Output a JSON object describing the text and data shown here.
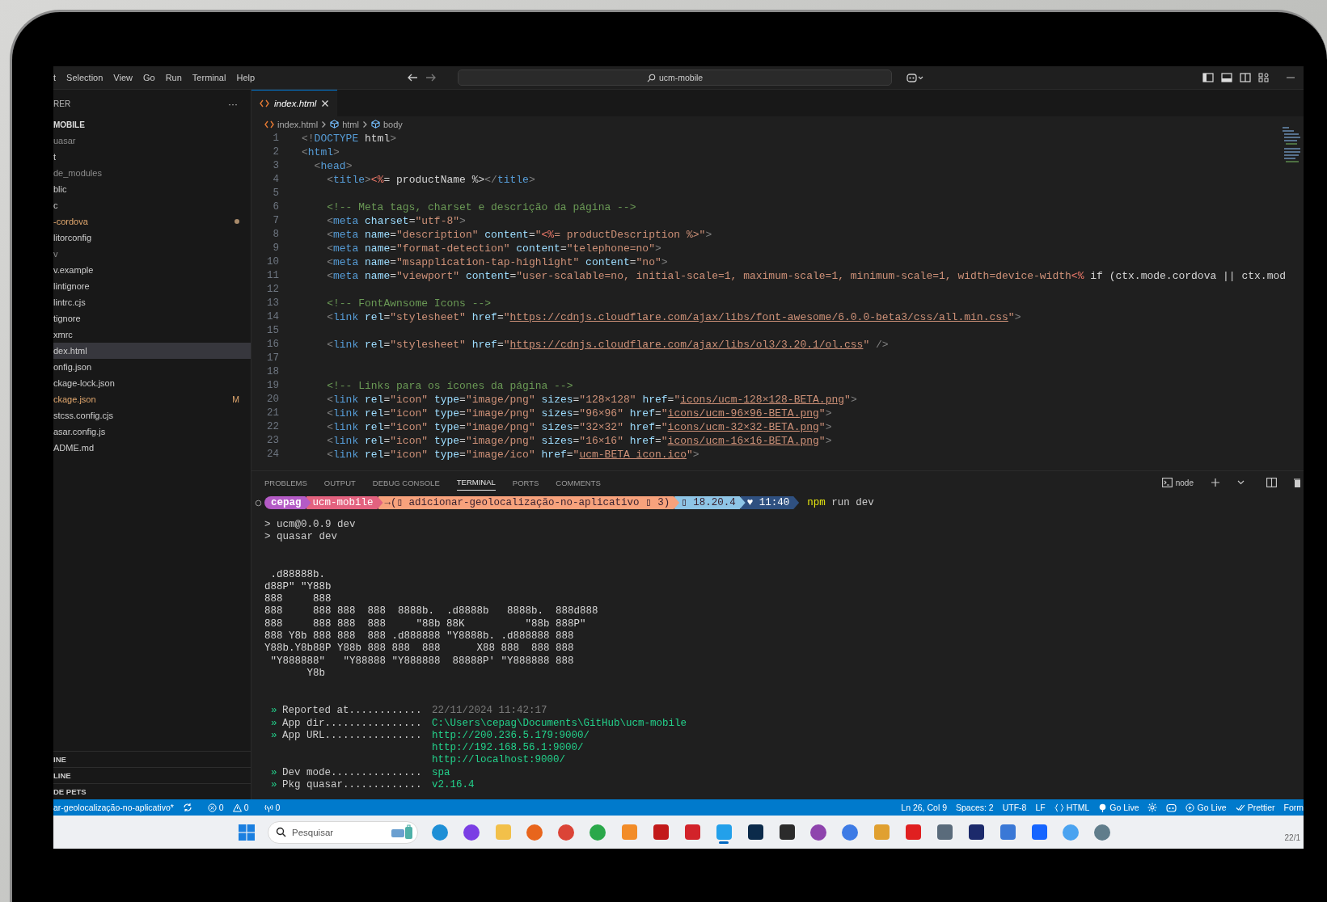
{
  "menu": [
    "t",
    "Selection",
    "View",
    "Go",
    "Run",
    "Terminal",
    "Help"
  ],
  "search": {
    "value": "ucm-mobile"
  },
  "sidebar": {
    "title": "RER",
    "more": "···",
    "project": "MOBILE",
    "items": [
      {
        "label": "uasar",
        "ignored": true,
        "modified": false,
        "selected": false
      },
      {
        "label": "t",
        "ignored": false,
        "modified": false,
        "selected": false
      },
      {
        "label": "de_modules",
        "ignored": true,
        "modified": false,
        "selected": false
      },
      {
        "label": "blic",
        "ignored": false,
        "modified": false,
        "selected": false
      },
      {
        "label": "c",
        "ignored": false,
        "modified": false,
        "selected": false
      },
      {
        "label": "-cordova",
        "ignored": false,
        "modified": true,
        "selected": false
      },
      {
        "label": "litorconfig",
        "ignored": false,
        "modified": false,
        "selected": false
      },
      {
        "label": "v",
        "ignored": true,
        "modified": false,
        "selected": false
      },
      {
        "label": "v.example",
        "ignored": false,
        "modified": false,
        "selected": false
      },
      {
        "label": "lintignore",
        "ignored": false,
        "modified": false,
        "selected": false
      },
      {
        "label": "lintrc.cjs",
        "ignored": false,
        "modified": false,
        "selected": false
      },
      {
        "label": "tignore",
        "ignored": false,
        "modified": false,
        "selected": false
      },
      {
        "label": "xmrc",
        "ignored": false,
        "modified": false,
        "selected": false
      },
      {
        "label": "dex.html",
        "ignored": false,
        "modified": false,
        "selected": true
      },
      {
        "label": "onfig.json",
        "ignored": false,
        "modified": false,
        "selected": false
      },
      {
        "label": "ckage-lock.json",
        "ignored": false,
        "modified": false,
        "selected": false
      },
      {
        "label": "ckage.json",
        "ignored": false,
        "modified": true,
        "badge": "M",
        "selected": false
      },
      {
        "label": "stcss.config.cjs",
        "ignored": false,
        "modified": false,
        "selected": false
      },
      {
        "label": "asar.config.js",
        "ignored": false,
        "modified": false,
        "selected": false
      },
      {
        "label": "ADME.md",
        "ignored": false,
        "modified": false,
        "selected": false
      }
    ],
    "sections": [
      "INE",
      "LINE",
      "DE PETS"
    ]
  },
  "editor": {
    "tab": "index.html",
    "breadcrumbs": [
      "index.html",
      "html",
      "body"
    ],
    "lines": [
      {
        "number": "1",
        "tokens": [
          {
            "kind": "punct",
            "text": "<!"
          },
          {
            "kind": "tag",
            "text": "DOCTYPE"
          },
          {
            "kind": "plain",
            "text": " html"
          },
          {
            "kind": "punct",
            "text": ">"
          }
        ]
      },
      {
        "number": "2",
        "tokens": [
          {
            "kind": "punct",
            "text": "<"
          },
          {
            "kind": "tag",
            "text": "html"
          },
          {
            "kind": "punct",
            "text": ">"
          }
        ]
      },
      {
        "number": "3",
        "tokens": [
          {
            "kind": "punct",
            "text": "  <"
          },
          {
            "kind": "tag",
            "text": "head"
          },
          {
            "kind": "punct",
            "text": ">"
          }
        ]
      },
      {
        "number": "4",
        "tokens": [
          {
            "kind": "punct",
            "text": "    <"
          },
          {
            "kind": "tag",
            "text": "title"
          },
          {
            "kind": "punct",
            "text": ">"
          },
          {
            "kind": "template",
            "text": "<%"
          },
          {
            "kind": "plain",
            "text": "= productName %>"
          },
          {
            "kind": "punct",
            "text": "</"
          },
          {
            "kind": "tag",
            "text": "title"
          },
          {
            "kind": "punct",
            "text": ">"
          }
        ]
      },
      {
        "number": "5"
      },
      {
        "number": "6",
        "tokens": [
          {
            "kind": "comment",
            "text": "    <!-- Meta tags, charset e descrição da página -->"
          }
        ]
      },
      {
        "number": "7",
        "tokens": [
          {
            "kind": "punct",
            "text": "    <"
          },
          {
            "kind": "tag",
            "text": "meta"
          },
          {
            "kind": "attr",
            "text": " charset"
          },
          {
            "kind": "plain",
            "text": "="
          },
          {
            "kind": "string",
            "text": "\"utf-8\""
          },
          {
            "kind": "punct",
            "text": ">"
          }
        ]
      },
      {
        "number": "8",
        "tokens": [
          {
            "kind": "punct",
            "text": "    <"
          },
          {
            "kind": "tag",
            "text": "meta"
          },
          {
            "kind": "attr",
            "text": " name"
          },
          {
            "kind": "plain",
            "text": "="
          },
          {
            "kind": "string",
            "text": "\"description\""
          },
          {
            "kind": "attr",
            "text": " content"
          },
          {
            "kind": "plain",
            "text": "="
          },
          {
            "kind": "string",
            "text": "\""
          },
          {
            "kind": "template",
            "text": "<%"
          },
          {
            "kind": "string",
            "text": "= productDescription %>\""
          },
          {
            "kind": "punct",
            "text": ">"
          }
        ]
      },
      {
        "number": "9",
        "tokens": [
          {
            "kind": "punct",
            "text": "    <"
          },
          {
            "kind": "tag",
            "text": "meta"
          },
          {
            "kind": "attr",
            "text": " name"
          },
          {
            "kind": "plain",
            "text": "="
          },
          {
            "kind": "string",
            "text": "\"format-detection\""
          },
          {
            "kind": "attr",
            "text": " content"
          },
          {
            "kind": "plain",
            "text": "="
          },
          {
            "kind": "string",
            "text": "\"telephone=no\""
          },
          {
            "kind": "punct",
            "text": ">"
          }
        ]
      },
      {
        "number": "10",
        "tokens": [
          {
            "kind": "punct",
            "text": "    <"
          },
          {
            "kind": "tag",
            "text": "meta"
          },
          {
            "kind": "attr",
            "text": " name"
          },
          {
            "kind": "plain",
            "text": "="
          },
          {
            "kind": "string",
            "text": "\"msapplication-tap-highlight\""
          },
          {
            "kind": "attr",
            "text": " content"
          },
          {
            "kind": "plain",
            "text": "="
          },
          {
            "kind": "string",
            "text": "\"no\""
          },
          {
            "kind": "punct",
            "text": ">"
          }
        ]
      },
      {
        "number": "11",
        "tokens": [
          {
            "kind": "punct",
            "text": "    <"
          },
          {
            "kind": "tag",
            "text": "meta"
          },
          {
            "kind": "attr",
            "text": " name"
          },
          {
            "kind": "plain",
            "text": "="
          },
          {
            "kind": "string",
            "text": "\"viewport\""
          },
          {
            "kind": "attr",
            "text": " content"
          },
          {
            "kind": "plain",
            "text": "="
          },
          {
            "kind": "string",
            "text": "\"user-scalable=no, initial-scale=1, maximum-scale=1, minimum-scale=1, width=device-width"
          },
          {
            "kind": "template",
            "text": "<%"
          },
          {
            "kind": "plain",
            "text": " if (ctx.mode.cordova || ctx.mod"
          }
        ]
      },
      {
        "number": "12"
      },
      {
        "number": "13",
        "tokens": [
          {
            "kind": "comment",
            "text": "    <!-- FontAwnsome Icons -->"
          }
        ]
      },
      {
        "number": "14",
        "tokens": [
          {
            "kind": "punct",
            "text": "    <"
          },
          {
            "kind": "tag",
            "text": "link"
          },
          {
            "kind": "attr",
            "text": " rel"
          },
          {
            "kind": "plain",
            "text": "="
          },
          {
            "kind": "string",
            "text": "\"stylesheet\""
          },
          {
            "kind": "attr",
            "text": " href"
          },
          {
            "kind": "plain",
            "text": "="
          },
          {
            "kind": "string",
            "text": "\""
          },
          {
            "kind": "url",
            "text": "https://cdnjs.cloudflare.com/ajax/libs/font-awesome/6.0.0-beta3/css/all.min.css"
          },
          {
            "kind": "string",
            "text": "\""
          },
          {
            "kind": "punct",
            "text": ">"
          }
        ]
      },
      {
        "number": "15"
      },
      {
        "number": "16",
        "tokens": [
          {
            "kind": "punct",
            "text": "    <"
          },
          {
            "kind": "tag",
            "text": "link"
          },
          {
            "kind": "attr",
            "text": " rel"
          },
          {
            "kind": "plain",
            "text": "="
          },
          {
            "kind": "string",
            "text": "\"stylesheet\""
          },
          {
            "kind": "attr",
            "text": " href"
          },
          {
            "kind": "plain",
            "text": "="
          },
          {
            "kind": "string",
            "text": "\""
          },
          {
            "kind": "url",
            "text": "https://cdnjs.cloudflare.com/ajax/libs/ol3/3.20.1/ol.css"
          },
          {
            "kind": "string",
            "text": "\""
          },
          {
            "kind": "punct",
            "text": " />"
          }
        ]
      },
      {
        "number": "17"
      },
      {
        "number": "18"
      },
      {
        "number": "19",
        "tokens": [
          {
            "kind": "comment",
            "text": "    <!-- Links para os ícones da página -->"
          }
        ]
      },
      {
        "number": "20",
        "tokens": [
          {
            "kind": "punct",
            "text": "    <"
          },
          {
            "kind": "tag",
            "text": "link"
          },
          {
            "kind": "attr",
            "text": " rel"
          },
          {
            "kind": "plain",
            "text": "="
          },
          {
            "kind": "string",
            "text": "\"icon\""
          },
          {
            "kind": "attr",
            "text": " type"
          },
          {
            "kind": "plain",
            "text": "="
          },
          {
            "kind": "string",
            "text": "\"image/png\""
          },
          {
            "kind": "attr",
            "text": " sizes"
          },
          {
            "kind": "plain",
            "text": "="
          },
          {
            "kind": "string",
            "text": "\"128×128\""
          },
          {
            "kind": "attr",
            "text": " href"
          },
          {
            "kind": "plain",
            "text": "="
          },
          {
            "kind": "string",
            "text": "\""
          },
          {
            "kind": "url",
            "text": "icons/ucm-128×128-BETA.png"
          },
          {
            "kind": "string",
            "text": "\""
          },
          {
            "kind": "punct",
            "text": ">"
          }
        ]
      },
      {
        "number": "21",
        "tokens": [
          {
            "kind": "punct",
            "text": "    <"
          },
          {
            "kind": "tag",
            "text": "link"
          },
          {
            "kind": "attr",
            "text": " rel"
          },
          {
            "kind": "plain",
            "text": "="
          },
          {
            "kind": "string",
            "text": "\"icon\""
          },
          {
            "kind": "attr",
            "text": " type"
          },
          {
            "kind": "plain",
            "text": "="
          },
          {
            "kind": "string",
            "text": "\"image/png\""
          },
          {
            "kind": "attr",
            "text": " sizes"
          },
          {
            "kind": "plain",
            "text": "="
          },
          {
            "kind": "string",
            "text": "\"96×96\""
          },
          {
            "kind": "attr",
            "text": " href"
          },
          {
            "kind": "plain",
            "text": "="
          },
          {
            "kind": "string",
            "text": "\""
          },
          {
            "kind": "url",
            "text": "icons/ucm-96×96-BETA.png"
          },
          {
            "kind": "string",
            "text": "\""
          },
          {
            "kind": "punct",
            "text": ">"
          }
        ]
      },
      {
        "number": "22",
        "tokens": [
          {
            "kind": "punct",
            "text": "    <"
          },
          {
            "kind": "tag",
            "text": "link"
          },
          {
            "kind": "attr",
            "text": " rel"
          },
          {
            "kind": "plain",
            "text": "="
          },
          {
            "kind": "string",
            "text": "\"icon\""
          },
          {
            "kind": "attr",
            "text": " type"
          },
          {
            "kind": "plain",
            "text": "="
          },
          {
            "kind": "string",
            "text": "\"image/png\""
          },
          {
            "kind": "attr",
            "text": " sizes"
          },
          {
            "kind": "plain",
            "text": "="
          },
          {
            "kind": "string",
            "text": "\"32×32\""
          },
          {
            "kind": "attr",
            "text": " href"
          },
          {
            "kind": "plain",
            "text": "="
          },
          {
            "kind": "string",
            "text": "\""
          },
          {
            "kind": "url",
            "text": "icons/ucm-32×32-BETA.png"
          },
          {
            "kind": "string",
            "text": "\""
          },
          {
            "kind": "punct",
            "text": ">"
          }
        ]
      },
      {
        "number": "23",
        "tokens": [
          {
            "kind": "punct",
            "text": "    <"
          },
          {
            "kind": "tag",
            "text": "link"
          },
          {
            "kind": "attr",
            "text": " rel"
          },
          {
            "kind": "plain",
            "text": "="
          },
          {
            "kind": "string",
            "text": "\"icon\""
          },
          {
            "kind": "attr",
            "text": " type"
          },
          {
            "kind": "plain",
            "text": "="
          },
          {
            "kind": "string",
            "text": "\"image/png\""
          },
          {
            "kind": "attr",
            "text": " sizes"
          },
          {
            "kind": "plain",
            "text": "="
          },
          {
            "kind": "string",
            "text": "\"16×16\""
          },
          {
            "kind": "attr",
            "text": " href"
          },
          {
            "kind": "plain",
            "text": "="
          },
          {
            "kind": "string",
            "text": "\""
          },
          {
            "kind": "url",
            "text": "icons/ucm-16×16-BETA.png"
          },
          {
            "kind": "string",
            "text": "\""
          },
          {
            "kind": "punct",
            "text": ">"
          }
        ]
      },
      {
        "number": "24",
        "tokens": [
          {
            "kind": "punct",
            "text": "    <"
          },
          {
            "kind": "tag",
            "text": "link"
          },
          {
            "kind": "attr",
            "text": " rel"
          },
          {
            "kind": "plain",
            "text": "="
          },
          {
            "kind": "string",
            "text": "\"icon\""
          },
          {
            "kind": "attr",
            "text": " type"
          },
          {
            "kind": "plain",
            "text": "="
          },
          {
            "kind": "string",
            "text": "\"image/ico\""
          },
          {
            "kind": "attr",
            "text": " href"
          },
          {
            "kind": "plain",
            "text": "="
          },
          {
            "kind": "string",
            "text": "\""
          },
          {
            "kind": "url",
            "text": "ucm-BETA_icon.ico"
          },
          {
            "kind": "string",
            "text": "\""
          },
          {
            "kind": "punct",
            "text": ">"
          }
        ]
      }
    ]
  },
  "panel": {
    "tabs": [
      {
        "label": "PROBLEMS",
        "selected": false
      },
      {
        "label": "OUTPUT",
        "selected": false
      },
      {
        "label": "DEBUG CONSOLE",
        "selected": false
      },
      {
        "label": "TERMINAL",
        "selected": true
      },
      {
        "label": "PORTS",
        "selected": false
      },
      {
        "label": "COMMENTS",
        "selected": false
      }
    ],
    "terminal_name": "node",
    "prompt": [
      {
        "text": "cepag",
        "color": "#b45bc6"
      },
      {
        "text": "ucm-mobile",
        "color": "#e3627f"
      },
      {
        "text": "→(▯ adicionar-geolocalização-no-aplicativo ▯ 3)",
        "color": "#f7a27c"
      },
      {
        "text": "▯ 18.20.4",
        "color": "#8ec5e6"
      },
      {
        "text": "♥ 11:40",
        "color": "#2f5080"
      }
    ],
    "command": {
      "program": "npm",
      "args": "run dev"
    },
    "output": [
      "> ucm@0.0.9 dev",
      "> quasar dev"
    ],
    "banner": [
      " .d88888b.",
      "d88P\" \"Y88b",
      "888     888",
      "888     888 888  888  8888b.  .d8888b   8888b.  888d888",
      "888     888 888  888     \"88b 88K          \"88b 888P\"",
      "888 Y8b 888 888  888 .d888888 \"Y8888b. .d888888 888",
      "Y88b.Y8b88P Y88b 888 888  888      X88 888  888 888",
      " \"Y888888\"   \"Y88888 \"Y888888  88888P' \"Y888888 888",
      "       Y8b"
    ],
    "info": [
      {
        "marker": "»",
        "label": "Reported at............",
        "kind": "timestamp",
        "values": [
          "22/11/2024 11:42:17"
        ]
      },
      {
        "marker": "»",
        "label": "App dir................",
        "kind": "value",
        "values": [
          "C:\\Users\\cepag\\Documents\\GitHub\\ucm-mobile"
        ]
      },
      {
        "marker": "»",
        "label": "App URL................",
        "kind": "value",
        "values": [
          "http://200.236.5.179:9000/",
          "http://192.168.56.1:9000/",
          "http://localhost:9000/"
        ]
      },
      {
        "marker": "»",
        "label": "Dev mode...............",
        "kind": "value",
        "values": [
          "spa"
        ]
      },
      {
        "marker": "»",
        "label": "Pkg quasar.............",
        "kind": "value",
        "values": [
          "v2.16.4"
        ]
      }
    ]
  },
  "status_bar": {
    "left": [
      {
        "kind": "branch",
        "text": "ar-geolocalização-no-aplicativo*"
      },
      {
        "kind": "sync"
      },
      {
        "kind": "errors",
        "text": "0"
      },
      {
        "kind": "warnings",
        "text": "0"
      },
      {
        "kind": "ports",
        "text": "0"
      }
    ],
    "right": [
      {
        "kind": "text",
        "text": "Ln 26, Col 9"
      },
      {
        "kind": "text",
        "text": "Spaces: 2"
      },
      {
        "kind": "text",
        "text": "UTF-8"
      },
      {
        "kind": "text",
        "text": "LF"
      },
      {
        "kind": "braces",
        "text": "HTML"
      },
      {
        "kind": "broadcast",
        "text": "Go Live"
      },
      {
        "kind": "gear"
      },
      {
        "kind": "robot"
      },
      {
        "kind": "play",
        "text": "Go Live"
      },
      {
        "kind": "check",
        "text": "Prettier"
      },
      {
        "kind": "text",
        "text": "Form"
      }
    ]
  },
  "taskbar": {
    "search": {
      "placeholder": "Pesquisar"
    },
    "apps": [
      {
        "kind": "circle",
        "color": "#1e8fd6",
        "selected": false
      },
      {
        "kind": "circle",
        "color": "#7b3fe4",
        "selected": false
      },
      {
        "kind": "square",
        "color": "#f2c04a",
        "selected": false
      },
      {
        "kind": "circle",
        "color": "#e8651c",
        "selected": false
      },
      {
        "kind": "circle",
        "color": "#db4437",
        "selected": false
      },
      {
        "kind": "circle",
        "color": "#2aa84a",
        "selected": false
      },
      {
        "kind": "square",
        "color": "#f28c28",
        "selected": false
      },
      {
        "kind": "square",
        "color": "#c21a1a",
        "selected": false
      },
      {
        "kind": "square",
        "color": "#d2232a",
        "selected": false
      },
      {
        "kind": "square",
        "color": "#23a0ea",
        "selected": true
      },
      {
        "kind": "square",
        "color": "#0b2a4a",
        "selected": false
      },
      {
        "kind": "square",
        "color": "#2b2b2b",
        "selected": false
      },
      {
        "kind": "circle",
        "color": "#8e44ad",
        "selected": false
      },
      {
        "kind": "circle",
        "color": "#3d7be5",
        "selected": false
      },
      {
        "kind": "square",
        "color": "#e0a030",
        "selected": false
      },
      {
        "kind": "square",
        "color": "#e02020",
        "selected": false
      },
      {
        "kind": "square",
        "color": "#5a6b7b",
        "selected": false
      },
      {
        "kind": "square",
        "color": "#1c2a6b",
        "selected": false
      },
      {
        "kind": "square",
        "color": "#3a78d6",
        "selected": false
      },
      {
        "kind": "square",
        "color": "#1565ff",
        "selected": false
      },
      {
        "kind": "circle",
        "color": "#4aa3f0",
        "selected": false
      },
      {
        "kind": "circle",
        "color": "#607d8b",
        "selected": false
      }
    ],
    "clock": "22/1"
  }
}
